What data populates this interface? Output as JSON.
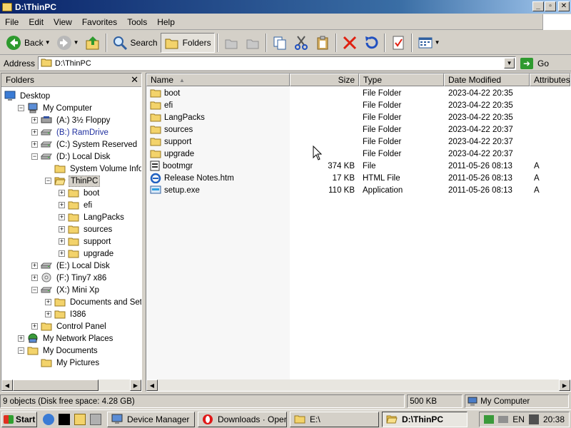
{
  "window": {
    "title": "D:\\ThinPC"
  },
  "menu": [
    "File",
    "Edit",
    "View",
    "Favorites",
    "Tools",
    "Help"
  ],
  "toolbar": {
    "back": "Back",
    "search": "Search",
    "folders": "Folders"
  },
  "address": {
    "label": "Address",
    "value": "D:\\ThinPC",
    "go": "Go"
  },
  "folders_pane": {
    "title": "Folders",
    "tree": [
      {
        "label": "Desktop",
        "level": 0,
        "icon": "desktop-icon",
        "exp": ""
      },
      {
        "label": "My Computer",
        "level": 1,
        "icon": "computer-icon",
        "exp": "-"
      },
      {
        "label": "(A:) 3½ Floppy",
        "level": 2,
        "icon": "floppy-icon",
        "exp": "+"
      },
      {
        "label": "(B:) RamDrive",
        "level": 2,
        "icon": "drive-icon",
        "exp": "+",
        "style": "ram"
      },
      {
        "label": "(C:) System Reserved",
        "level": 2,
        "icon": "drive-icon",
        "exp": "+"
      },
      {
        "label": "(D:) Local Disk",
        "level": 2,
        "icon": "drive-icon",
        "exp": "-"
      },
      {
        "label": "System Volume Information",
        "level": 3,
        "icon": "folder-icon",
        "exp": ""
      },
      {
        "label": "ThinPC",
        "level": 3,
        "icon": "folder-open-icon",
        "exp": "-",
        "selected": true
      },
      {
        "label": "boot",
        "level": 4,
        "icon": "folder-icon",
        "exp": "+"
      },
      {
        "label": "efi",
        "level": 4,
        "icon": "folder-icon",
        "exp": "+"
      },
      {
        "label": "LangPacks",
        "level": 4,
        "icon": "folder-icon",
        "exp": "+"
      },
      {
        "label": "sources",
        "level": 4,
        "icon": "folder-icon",
        "exp": "+"
      },
      {
        "label": "support",
        "level": 4,
        "icon": "folder-icon",
        "exp": "+"
      },
      {
        "label": "upgrade",
        "level": 4,
        "icon": "folder-icon",
        "exp": "+"
      },
      {
        "label": "(E:) Local Disk",
        "level": 2,
        "icon": "drive-icon",
        "exp": "+"
      },
      {
        "label": "(F:) Tiny7 x86",
        "level": 2,
        "icon": "cdrom-icon",
        "exp": "+"
      },
      {
        "label": "(X:) Mini Xp",
        "level": 2,
        "icon": "drive-icon",
        "exp": "-"
      },
      {
        "label": "Documents and Settings",
        "level": 3,
        "icon": "folder-icon",
        "exp": "+"
      },
      {
        "label": "I386",
        "level": 3,
        "icon": "folder-icon",
        "exp": "+"
      },
      {
        "label": "Control Panel",
        "level": 2,
        "icon": "folder-icon",
        "exp": "+"
      },
      {
        "label": "My Network Places",
        "level": 1,
        "icon": "network-icon",
        "exp": "+"
      },
      {
        "label": "My Documents",
        "level": 1,
        "icon": "folder-icon",
        "exp": "-"
      },
      {
        "label": "My Pictures",
        "level": 2,
        "icon": "folder-icon",
        "exp": ""
      }
    ]
  },
  "file_list": {
    "columns": [
      "Name",
      "Size",
      "Type",
      "Date Modified",
      "Attributes"
    ],
    "rows": [
      {
        "name": "boot",
        "size": "",
        "type": "File Folder",
        "date": "2023-04-22 20:35",
        "attr": "",
        "icon": "folder-icon"
      },
      {
        "name": "efi",
        "size": "",
        "type": "File Folder",
        "date": "2023-04-22 20:35",
        "attr": "",
        "icon": "folder-icon"
      },
      {
        "name": "LangPacks",
        "size": "",
        "type": "File Folder",
        "date": "2023-04-22 20:35",
        "attr": "",
        "icon": "folder-icon"
      },
      {
        "name": "sources",
        "size": "",
        "type": "File Folder",
        "date": "2023-04-22 20:37",
        "attr": "",
        "icon": "folder-icon"
      },
      {
        "name": "support",
        "size": "",
        "type": "File Folder",
        "date": "2023-04-22 20:37",
        "attr": "",
        "icon": "folder-icon"
      },
      {
        "name": "upgrade",
        "size": "",
        "type": "File Folder",
        "date": "2023-04-22 20:37",
        "attr": "",
        "icon": "folder-icon"
      },
      {
        "name": "bootmgr",
        "size": "374 KB",
        "type": "File",
        "date": "2011-05-26 08:13",
        "attr": "A",
        "icon": "file-icon"
      },
      {
        "name": "Release Notes.htm",
        "size": "17 KB",
        "type": "HTML File",
        "date": "2011-05-26 08:13",
        "attr": "A",
        "icon": "ie-icon"
      },
      {
        "name": "setup.exe",
        "size": "110 KB",
        "type": "Application",
        "date": "2011-05-26 08:13",
        "attr": "A",
        "icon": "setup-icon"
      }
    ]
  },
  "status": {
    "objects": "9 objects (Disk free space: 4.28 GB)",
    "size": "500 KB",
    "location": "My Computer"
  },
  "taskbar": {
    "start": "Start",
    "tasks": [
      {
        "label": "Device Manager",
        "icon": "device-manager-icon"
      },
      {
        "label": "Downloads · Opera",
        "icon": "opera-icon"
      },
      {
        "label": "E:\\",
        "icon": "folder-icon"
      },
      {
        "label": "D:\\ThinPC",
        "icon": "folder-open-icon",
        "active": true
      }
    ],
    "lang": "EN",
    "clock": "20:38"
  },
  "colors": {
    "title_start": "#0a246a",
    "title_end": "#a6caf0",
    "face": "#d4d0c8",
    "folder": "#f3d36b"
  }
}
